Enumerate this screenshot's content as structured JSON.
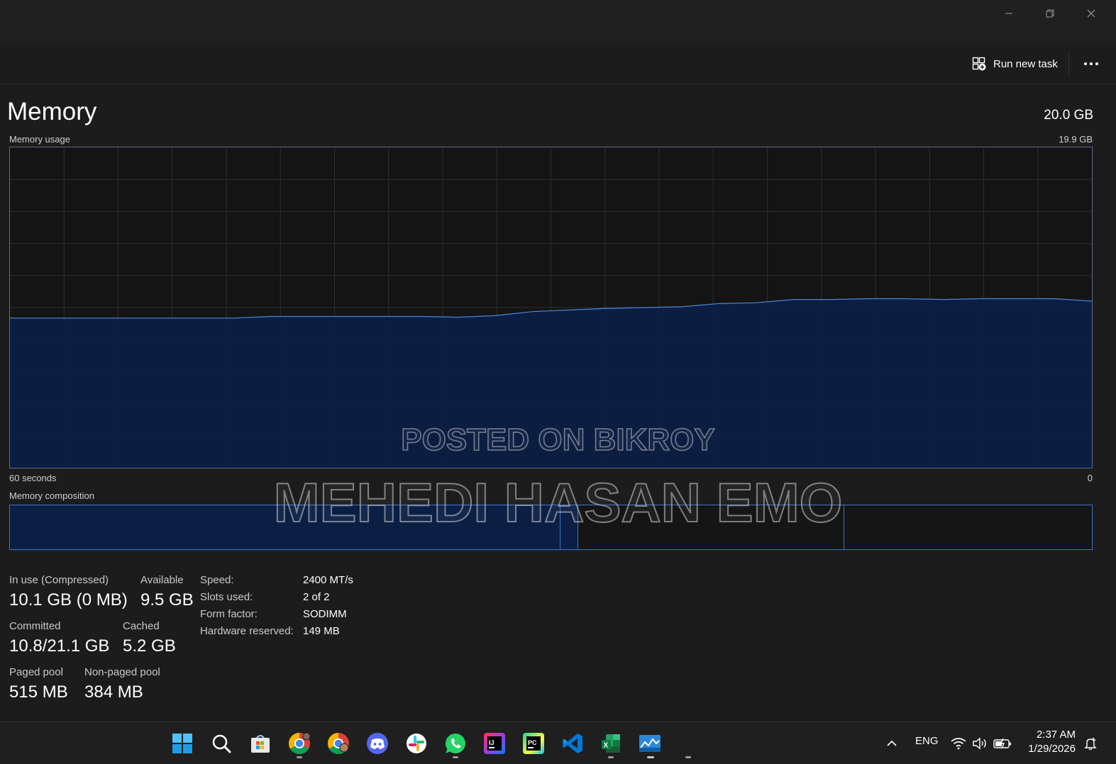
{
  "toolbar": {
    "run_new_task": "Run new task"
  },
  "header": {
    "title": "Memory",
    "total": "20.0 GB"
  },
  "graph": {
    "label": "Memory usage",
    "max_label": "19.9 GB",
    "time_span_label": "60 seconds",
    "min_label": "0",
    "max_gb": 19.9,
    "fill_color": "#0b1f45",
    "line_color": "#4a86d8",
    "usage_gb": [
      9.3,
      9.3,
      9.3,
      9.3,
      9.3,
      9.3,
      9.3,
      9.4,
      9.4,
      9.4,
      9.4,
      9.4,
      9.35,
      9.45,
      9.7,
      9.8,
      9.9,
      9.95,
      10.0,
      10.2,
      10.25,
      10.45,
      10.45,
      10.5,
      10.5,
      10.45,
      10.5,
      10.5,
      10.5,
      10.35
    ]
  },
  "composition": {
    "label": "Memory composition"
  },
  "stats": {
    "in_use_label": "In use (Compressed)",
    "in_use_value": "10.1 GB (0 MB)",
    "available_label": "Available",
    "available_value": "9.5 GB",
    "committed_label": "Committed",
    "committed_value": "10.8/21.1 GB",
    "cached_label": "Cached",
    "cached_value": "5.2 GB",
    "paged_label": "Paged pool",
    "paged_value": "515 MB",
    "nonpaged_label": "Non-paged pool",
    "nonpaged_value": "384 MB"
  },
  "specs": {
    "speed_label": "Speed:",
    "speed_value": "2400 MT/s",
    "slots_label": "Slots used:",
    "slots_value": "2 of 2",
    "form_label": "Form factor:",
    "form_value": "SODIMM",
    "reserved_label": "Hardware reserved:",
    "reserved_value": "149 MB"
  },
  "watermark": {
    "line1": "POSTED ON BIKROY",
    "line2": "MEHEDI HASAN EMO"
  },
  "taskbar": {
    "icons": [
      "windows-start-icon",
      "search-icon",
      "microsoft-store-icon",
      "chrome-icon",
      "chrome-profile-icon",
      "discord-icon",
      "slack-icon",
      "whatsapp-icon",
      "intellij-icon",
      "pycharm-icon",
      "vscode-icon",
      "excel-icon",
      "task-manager-icon"
    ],
    "language": "ENG",
    "time": "2:37 AM",
    "date": "1/29/2026"
  }
}
